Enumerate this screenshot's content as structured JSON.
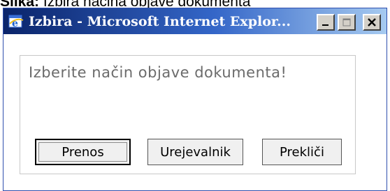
{
  "caption": {
    "label": "Slika:",
    "text": "Izbira načina objave dokumenta"
  },
  "window": {
    "title": "Izbira - Microsoft Internet Explor...",
    "icons": {
      "app": "internet-explorer-icon",
      "minimize": "minimize-icon",
      "maximize": "maximize-icon",
      "close": "close-icon"
    }
  },
  "dialog": {
    "prompt": "Izberite način objave dokumenta!",
    "buttons": {
      "prenos": "Prenos",
      "urejevalnik": "Urejevalnik",
      "preklici": "Prekliči"
    }
  },
  "colors": {
    "titlebar_start": "#0a246a",
    "titlebar_end": "#a6caf0",
    "button_face": "#d4d0c8"
  }
}
